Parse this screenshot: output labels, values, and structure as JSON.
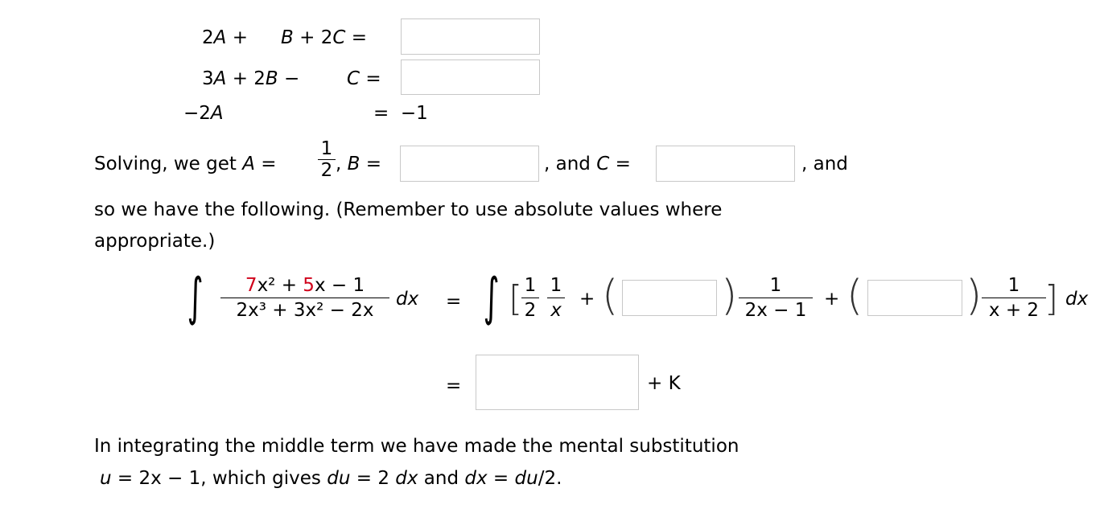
{
  "system": {
    "row1": {
      "a": "2",
      "av": "A",
      "op1": "+",
      "bv": "B",
      "op2": "+",
      "c": "2",
      "cv": "C",
      "eq": "="
    },
    "row2": {
      "a": "3",
      "av": "A",
      "op1": "+",
      "b": "2",
      "bv": "B",
      "op2": "−",
      "cv": "C",
      "eq": "="
    },
    "row3": {
      "a": "−2",
      "av": "A",
      "eq": "=",
      "rhs": "−1"
    },
    "row1_value": "",
    "row2_value": ""
  },
  "solving": {
    "prefix": "Solving, we get ",
    "A": "A",
    "eq": " = ",
    "A_num": "1",
    "A_den": "2",
    "comma": ",",
    "B": "B",
    "eqB": " =",
    "B_value": "",
    "and_c": ", and ",
    "C": "C",
    "eqC": " =",
    "C_value": "",
    "and": ",  and"
  },
  "sentence": {
    "line1": "so we have the following. (Remember to use absolute values where",
    "line2": "appropriate.)"
  },
  "integral": {
    "num_a": "7",
    "num_b": "x² + ",
    "num_c": "5",
    "num_d": "x − 1",
    "den": "2x³ + 3x² − 2x",
    "dx": "dx",
    "eq": "=",
    "t1_num": "1",
    "t1_den": "2",
    "t2_num": "1",
    "t2_den": "x",
    "plus": "+",
    "coef1_value": "",
    "f2_num": "1",
    "f2_den": "2x − 1",
    "coef2_value": "",
    "f3_num": "1",
    "f3_den": "x + 2",
    "dx2": "dx",
    "eq2": "=",
    "result_value": "",
    "plus_k": "+ K"
  },
  "note": {
    "line1": "In integrating the middle term we have made the mental substitution",
    "line2_u": "u",
    "line2_a": " = 2x − 1,  which gives  ",
    "line2_du": "du",
    "line2_b": " = 2 ",
    "line2_dx": "dx",
    "line2_c": "  and  ",
    "line2_dx2": "dx",
    "line2_d": " = ",
    "line2_du2": "du",
    "line2_e": "/2."
  }
}
